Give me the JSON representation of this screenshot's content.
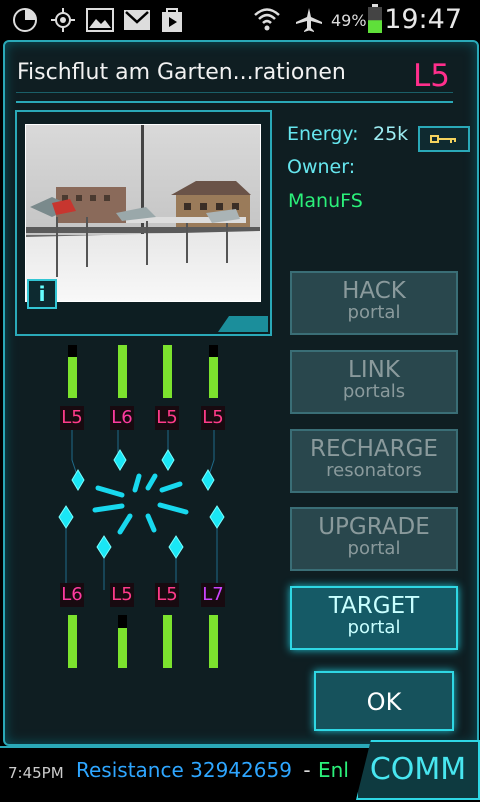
{
  "status_bar": {
    "time": "19:47",
    "battery_pct": "49%",
    "battery_level": 0.49
  },
  "portal": {
    "title": "Fischflut am Garten...rationen",
    "level": "L5",
    "energy_label": "Energy:",
    "energy_value": "25k",
    "owner_label": "Owner:",
    "owner_name": "ManuFS",
    "info_label": "i"
  },
  "actions": [
    {
      "big": "HACK",
      "small": "portal"
    },
    {
      "big": "LINK",
      "small": "portals"
    },
    {
      "big": "RECHARGE",
      "small": "resonators"
    },
    {
      "big": "UPGRADE",
      "small": "portal"
    },
    {
      "big": "TARGET",
      "small": "portal"
    }
  ],
  "ok_label": "OK",
  "resonators_top": [
    {
      "level": "L5",
      "color": "#ff3b8a",
      "fill": 0.78
    },
    {
      "level": "L6",
      "color": "#ff3ba0",
      "fill": 1.0
    },
    {
      "level": "L5",
      "color": "#ff3b8a",
      "fill": 1.0
    },
    {
      "level": "L5",
      "color": "#ff3b8a",
      "fill": 0.78
    }
  ],
  "resonators_bottom": [
    {
      "level": "L6",
      "color": "#ff3ba0",
      "fill": 1.0
    },
    {
      "level": "L5",
      "color": "#ff3b8a",
      "fill": 0.75
    },
    {
      "level": "L5",
      "color": "#ff3b8a",
      "fill": 1.0
    },
    {
      "level": "L7",
      "color": "#cc44ff",
      "fill": 1.0
    }
  ],
  "bottom_bar": {
    "time": "7:45PM",
    "message": "Resistance 32942659",
    "dash": " - ",
    "enlightened": "Enl",
    "comm_label": "COMM"
  },
  "colors": {
    "accent": "#2aa9b8",
    "resistance": "#2ea6ff",
    "enlightened": "#2bf07a",
    "resonator_bar": "#7ce32e"
  }
}
